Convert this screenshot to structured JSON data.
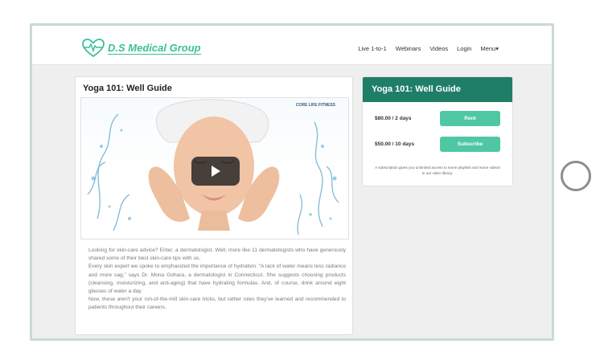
{
  "header": {
    "logo_text": "D.S Medical Group",
    "nav": [
      "Live 1-to-1",
      "Webinars",
      "Videos",
      "Login",
      "Menu▾"
    ]
  },
  "main": {
    "title": "Yoga 101: Well Guide",
    "video_brand": "CORE LIFE FITNESS",
    "paragraphs": [
      "Looking for skin-care advice? Enter, a dermatologist. Well, more like 11 dermatologists who have generously shared some of their best skin-care tips with us.",
      "Every skin expert we spoke to emphasized the importance of hydration. “A lack of water means less radiance and more sag,” says Dr. Mona Gohara, a dermatologist in Connecticut. She suggests choosing products (cleansing, moisturizing, and anti-aging) that have hydrating formulas. And, of course, drink around eight glasses of water a day.",
      "Now, these aren't your run-of-the-mill skin-care tricks, but rather rules they've learned and recommended to patients throughout their careers."
    ]
  },
  "side": {
    "title": "Yoga 101: Well Guide",
    "plans": [
      {
        "price": "$80.00 / 2 days",
        "action": "Rent"
      },
      {
        "price": "$50.00 / 10 days",
        "action": "Subscribe"
      }
    ],
    "note": "A subscription gives you unlimited access to some playlists and some videos in our video library."
  },
  "colors": {
    "brand": "#3bbf9a",
    "header_dark": "#1f7e67",
    "button": "#4fc7a3"
  }
}
